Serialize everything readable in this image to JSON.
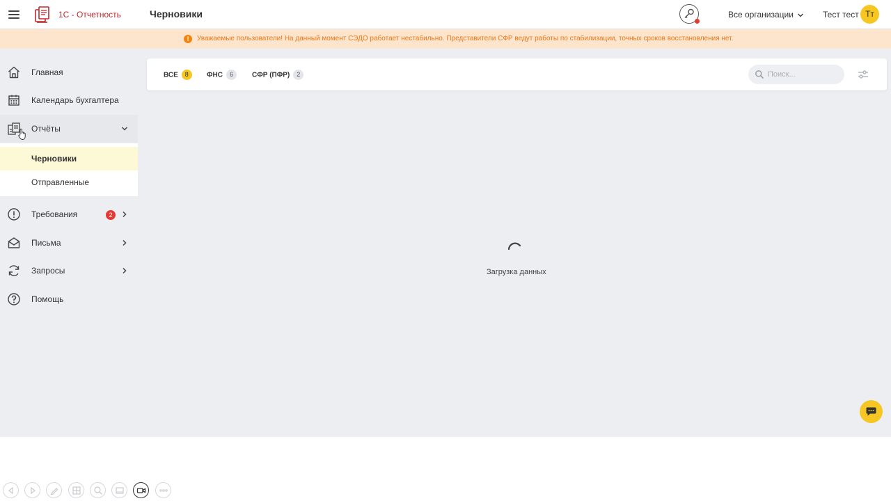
{
  "header": {
    "app_name": "1С - Отчетность",
    "page_title": "Черновики",
    "org_select": "Все организации",
    "user_name": "Тест тест",
    "avatar_initials": "Тт"
  },
  "banner": {
    "icon": "!",
    "text": "Уважаемые пользователи! На данный момент СЭДО работает нестабильно. Представители СФР ведут работы по стабилизации, точных сроков восстановления нет."
  },
  "sidebar": {
    "items": [
      {
        "label": "Главная",
        "icon": "home-icon"
      },
      {
        "label": "Календарь бухгалтера",
        "icon": "calendar-icon"
      },
      {
        "label": "Отчёты",
        "icon": "reports-icon",
        "expanded": true
      },
      {
        "label": "Требования",
        "icon": "alert-circle-icon",
        "badge": "2"
      },
      {
        "label": "Письма",
        "icon": "envelope-icon"
      },
      {
        "label": "Запросы",
        "icon": "refresh-icon"
      },
      {
        "label": "Помощь",
        "icon": "help-icon"
      }
    ],
    "subitems": [
      {
        "label": "Черновики",
        "active": true
      },
      {
        "label": "Отправленные",
        "active": false
      }
    ]
  },
  "tabs": [
    {
      "label": "ВСЕ",
      "count": "8"
    },
    {
      "label": "ФНС",
      "count": "6"
    },
    {
      "label": "СФР (ПФР)",
      "count": "2"
    }
  ],
  "search": {
    "placeholder": "Поиск...",
    "value": ""
  },
  "loading": {
    "text": "Загрузка данных"
  },
  "colors": {
    "accent": "#f6c623",
    "brand": "#c0282d",
    "banner_bg": "#fde4cc",
    "banner_text": "#e8791a",
    "badge": "#e53935"
  },
  "toolbar": {
    "icons": [
      "back-icon",
      "forward-icon",
      "pen-icon",
      "grid-icon",
      "zoom-icon",
      "screen-icon",
      "video-icon",
      "more-icon"
    ]
  }
}
